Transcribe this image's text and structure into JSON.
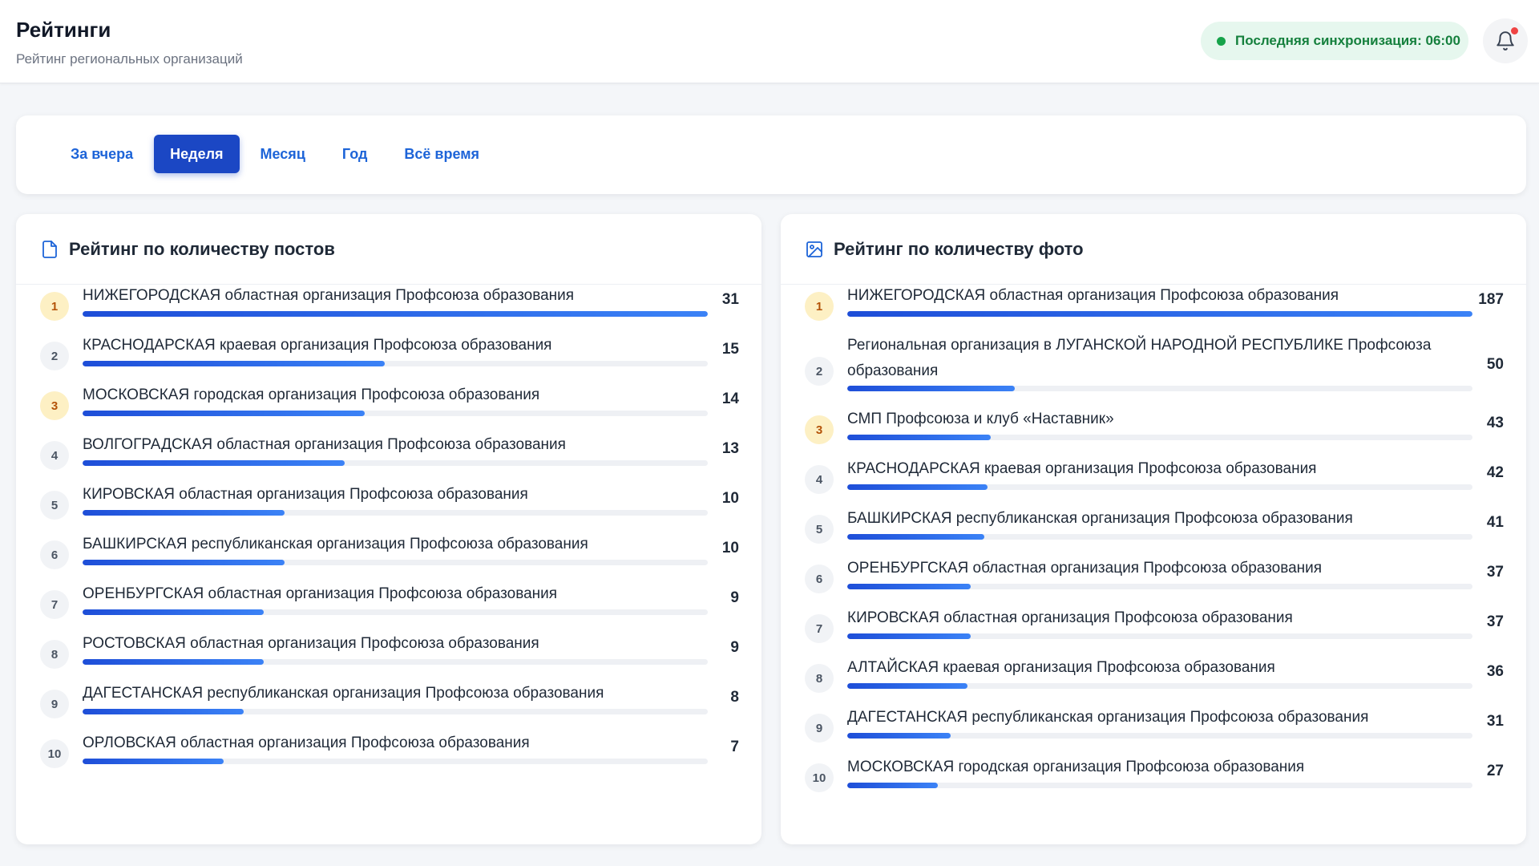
{
  "header": {
    "title": "Рейтинги",
    "subtitle": "Рейтинг региональных организаций",
    "sync_status": "Последняя синхронизация: 06:00"
  },
  "tabs": [
    {
      "label": "За вчера",
      "active": false
    },
    {
      "label": "Неделя",
      "active": true
    },
    {
      "label": "Месяц",
      "active": false
    },
    {
      "label": "Год",
      "active": false
    },
    {
      "label": "Всё время",
      "active": false
    }
  ],
  "colors": {
    "accent": "#1b47c4",
    "bar_start": "#1e4ed8",
    "bar_end": "#3b82f6",
    "sync_green": "#15803d",
    "gold_badge": "#fdf0c4"
  },
  "posts_panel": {
    "title": "Рейтинг по количеству постов",
    "icon": "document-icon",
    "max": 31,
    "items": [
      {
        "rank": "1",
        "name": "НИЖЕГОРОДСКАЯ областная организация Профсоюза образования",
        "count": 31
      },
      {
        "rank": "2",
        "name": "КРАСНОДАРСКАЯ краевая организация Профсоюза образования",
        "count": 15
      },
      {
        "rank": "3",
        "name": "МОСКОВСКАЯ городская организация Профсоюза образования",
        "count": 14
      },
      {
        "rank": "4",
        "name": "ВОЛГОГРАДСКАЯ областная организация Профсоюза образования",
        "count": 13
      },
      {
        "rank": "5",
        "name": "КИРОВСКАЯ областная организация Профсоюза образования",
        "count": 10
      },
      {
        "rank": "6",
        "name": "БАШКИРСКАЯ республиканская организация Профсоюза образования",
        "count": 10
      },
      {
        "rank": "7",
        "name": "ОРЕНБУРГСКАЯ областная организация Профсоюза образования",
        "count": 9
      },
      {
        "rank": "8",
        "name": "РОСТОВСКАЯ областная организация Профсоюза образования",
        "count": 9
      },
      {
        "rank": "9",
        "name": "ДАГЕСТАНСКАЯ республиканская организация Профсоюза образования",
        "count": 8
      },
      {
        "rank": "10",
        "name": "ОРЛОВСКАЯ областная организация Профсоюза образования",
        "count": 7
      }
    ]
  },
  "photos_panel": {
    "title": "Рейтинг по количеству фото",
    "icon": "image-icon",
    "max": 187,
    "items": [
      {
        "rank": "1",
        "name": "НИЖЕГОРОДСКАЯ областная организация Профсоюза образования",
        "count": 187
      },
      {
        "rank": "2",
        "name": "Региональная организация в ЛУГАНСКОЙ НАРОДНОЙ РЕСПУБЛИКЕ Профсоюза образования",
        "count": 50
      },
      {
        "rank": "3",
        "name": "СМП Профсоюза и клуб «Наставник»",
        "count": 43
      },
      {
        "rank": "4",
        "name": "КРАСНОДАРСКАЯ краевая организация Профсоюза образования",
        "count": 42
      },
      {
        "rank": "5",
        "name": "БАШКИРСКАЯ республиканская организация Профсоюза образования",
        "count": 41
      },
      {
        "rank": "6",
        "name": "ОРЕНБУРГСКАЯ областная организация Профсоюза образования",
        "count": 37
      },
      {
        "rank": "7",
        "name": "КИРОВСКАЯ областная организация Профсоюза образования",
        "count": 37
      },
      {
        "rank": "8",
        "name": "АЛТАЙСКАЯ краевая организация Профсоюза образования",
        "count": 36
      },
      {
        "rank": "9",
        "name": "ДАГЕСТАНСКАЯ республиканская организация Профсоюза образования",
        "count": 31
      },
      {
        "rank": "10",
        "name": "МОСКОВСКАЯ городская организация Профсоюза образования",
        "count": 27
      }
    ]
  }
}
